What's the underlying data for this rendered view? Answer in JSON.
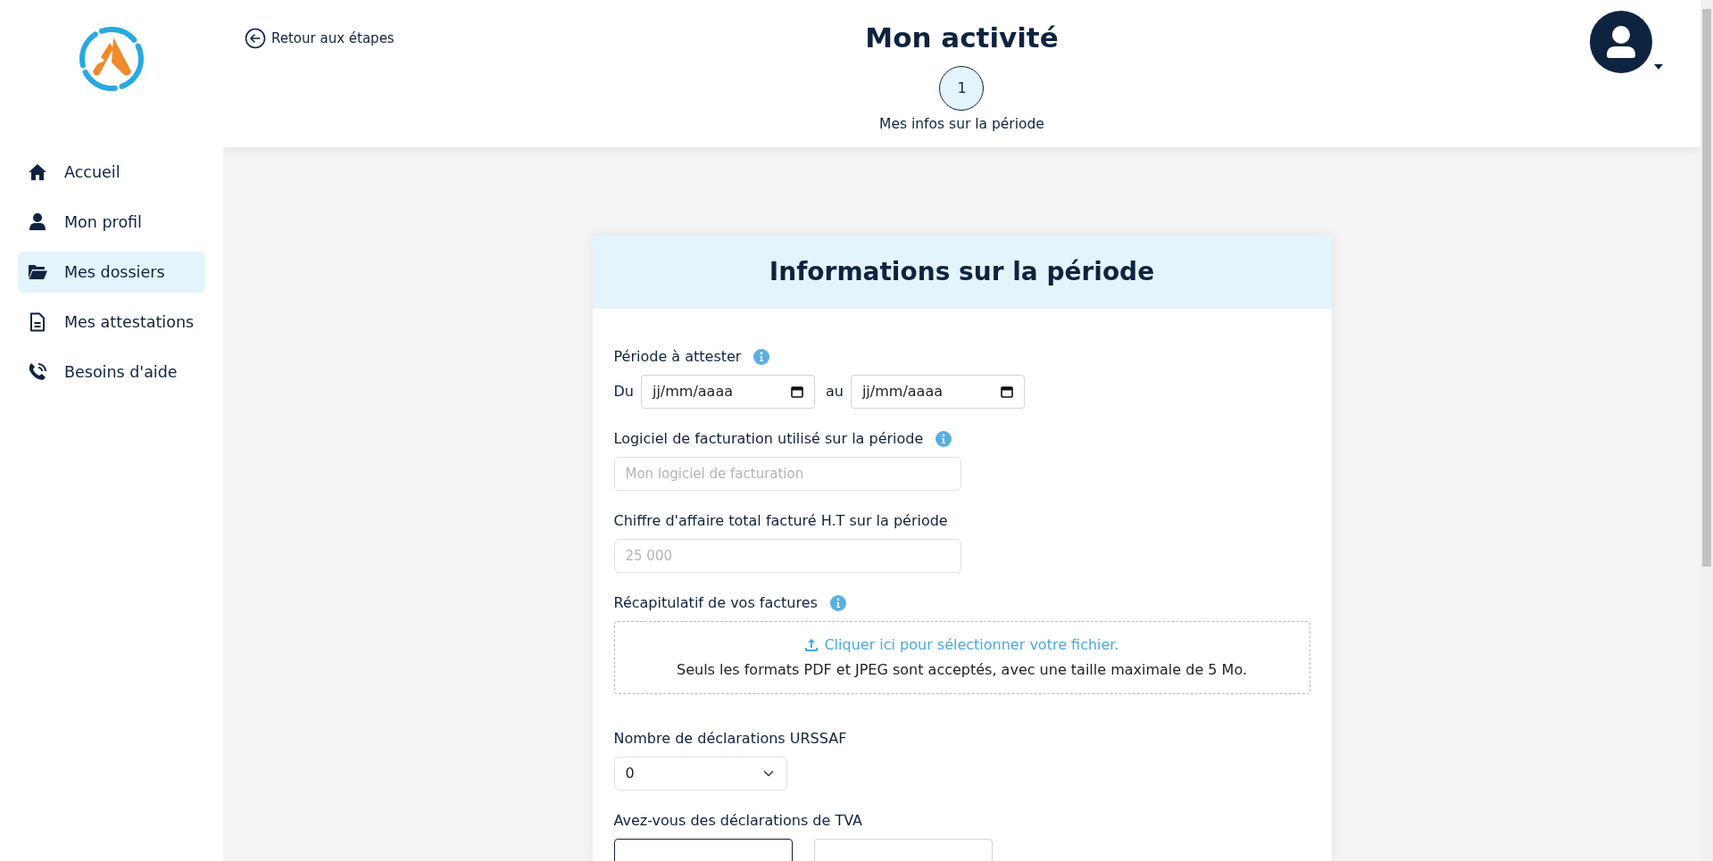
{
  "sidebar": {
    "items": [
      {
        "kind": "home",
        "label": "Accueil",
        "selected": false
      },
      {
        "kind": "user",
        "label": "Mon profil",
        "selected": false
      },
      {
        "kind": "folder",
        "label": "Mes dossiers",
        "selected": true
      },
      {
        "kind": "document",
        "label": "Mes attestations",
        "selected": false
      },
      {
        "kind": "phone",
        "label": "Besoins d'aide",
        "selected": false
      }
    ]
  },
  "header": {
    "back_link": "Retour aux étapes",
    "title": "Mon activité",
    "steps": [
      {
        "number": "1",
        "label": "Mes infos sur la période",
        "selected": true
      }
    ]
  },
  "form": {
    "title": "Informations sur la période",
    "fields": [
      {
        "kind": "date_range",
        "label": "Période à attester",
        "info": true,
        "from_label": "Du",
        "from_placeholder": "jj/mm/aaaa",
        "to_label": "au",
        "to_placeholder": "jj/mm/aaaa"
      },
      {
        "kind": "text",
        "label": "Logiciel de facturation utilisé sur la période",
        "info": true,
        "placeholder": "Mon logiciel de facturation"
      },
      {
        "kind": "text",
        "label": "Chiffre d'affaire total facturé H.T sur la période",
        "info": false,
        "placeholder": "25 000"
      },
      {
        "kind": "upload",
        "label": "Récapitulatif de vos factures",
        "info": true,
        "link": "Cliquer ici pour sélectionner votre fichier.",
        "note": "Seuls les formats PDF et JPEG sont acceptés, avec une taille maximale de 5 Mo."
      },
      {
        "kind": "select",
        "label": "Nombre de déclarations URSSAF",
        "info": false,
        "value": "0"
      },
      {
        "kind": "choice",
        "label": "Avez-vous des déclarations de TVA",
        "info": false,
        "options": [
          {
            "selected": true
          },
          {
            "selected": false
          }
        ]
      }
    ]
  }
}
